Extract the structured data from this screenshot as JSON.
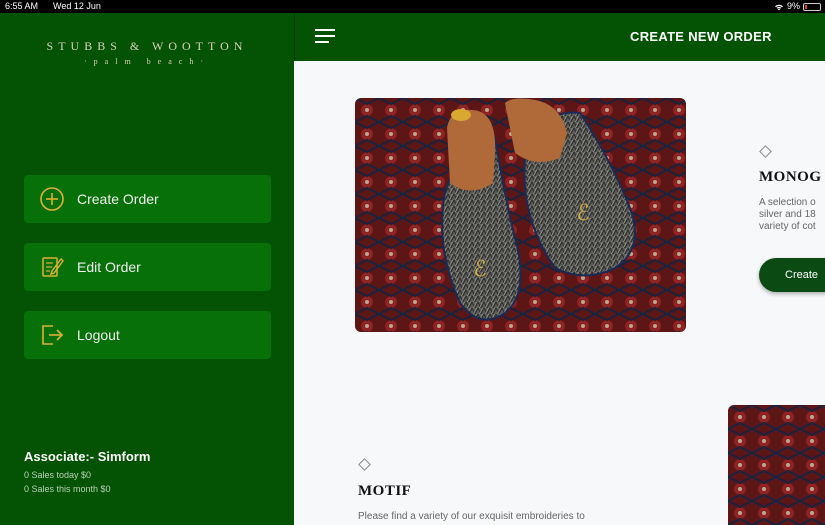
{
  "status_bar": {
    "time": "6:55 AM",
    "date": "Wed 12 Jun",
    "battery": "9%"
  },
  "brand": {
    "name": "STUBBS & WOOTTON",
    "tagline": "·palm beach·"
  },
  "sidebar": {
    "items": [
      {
        "label": "Create Order",
        "icon": "plus-circle-icon"
      },
      {
        "label": "Edit Order",
        "icon": "edit-document-icon"
      },
      {
        "label": "Logout",
        "icon": "logout-icon"
      }
    ],
    "associate": "Associate:- Simform",
    "sales_today": "0 Sales today $0",
    "sales_month": "0 Sales this month $0"
  },
  "header": {
    "title": "CREATE NEW ORDER"
  },
  "sections": [
    {
      "title": "MONOG",
      "desc_lines": [
        "A selection o",
        "silver and 18",
        "variety of cot"
      ],
      "button_label": "Create"
    },
    {
      "title": "MOTIF",
      "desc_lines": [
        "Please find a variety of our exquisit embroideries to"
      ]
    }
  ],
  "colors": {
    "sidebar_bg": "#045204",
    "nav_button_bg": "#087008",
    "icon_accent": "#e0b030",
    "create_button_bg": "#0b4a12",
    "main_bg": "#f6f8fa"
  }
}
